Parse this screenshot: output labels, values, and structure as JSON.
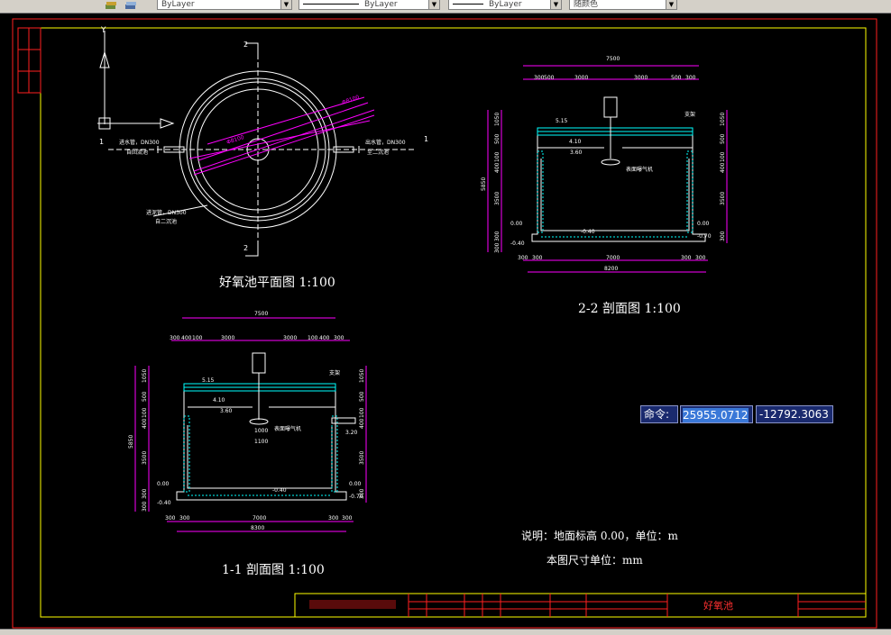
{
  "toolbar": {
    "layer_icon": "layers-icon",
    "layer_state_icon": "layer-states-icon",
    "color_value": "ByLayer",
    "linetype_value": "ByLayer",
    "lineweight_value": "ByLayer",
    "plotstyle_value": "随颜色"
  },
  "drawing": {
    "plan_title": "好氧池平面图 1:100",
    "section22_title": "2-2 剖面图 1:100",
    "section11_title": "1-1 剖面图 1:100",
    "note1": "说明：地面标高 0.00，单位：m",
    "note2": "本图尺寸单位：mm",
    "title_block_name": "好氧池",
    "plan": {
      "diameter": "Φ8100",
      "section_mark_2": "2",
      "section_mark_1": "1",
      "inlet_label": "进水管，DN300",
      "inlet_sub": "自回流池",
      "outlet_label": "出水管，DN300",
      "outlet_sub": "至二沉池",
      "bottom_label": "进泥管，DN300",
      "bottom_sub": "自二沉池",
      "axis_y": "Y",
      "axis_x": "X"
    },
    "sec22": {
      "total_width": "7500",
      "top_dims": [
        "300",
        "500",
        "3000",
        "3000",
        "500",
        "300"
      ],
      "bottom_dims": [
        "300",
        "300",
        "7000",
        "300",
        "300"
      ],
      "overall_bottom": "8200",
      "left_height": "5850",
      "left_dims": [
        "1050",
        "500",
        "100",
        "400",
        "3500",
        "300",
        "300"
      ],
      "right_dims": [
        "1050",
        "500",
        "100",
        "400",
        "3500",
        "300"
      ],
      "elev_top": "5.15",
      "elev_1": "4.10",
      "elev_2": "3.60",
      "elev_left": "0.00",
      "elev_left_low": "-0.40",
      "elev_bottom": "-0.40",
      "elev_right": "0.00",
      "elev_right_low": "-0.70",
      "label_motor": "支架",
      "label_aerator": "表面曝气机"
    },
    "sec11": {
      "total_width": "7500",
      "top_dims": [
        "300",
        "400",
        "100",
        "3000",
        "3000",
        "100",
        "400",
        "300"
      ],
      "bottom_dims": [
        "300",
        "300",
        "7000",
        "300",
        "300"
      ],
      "overall_bottom": "8300",
      "left_height": "5850",
      "left_dims": [
        "1050",
        "500",
        "100",
        "400",
        "3500",
        "300",
        "300"
      ],
      "right_dims": [
        "1050",
        "500",
        "100",
        "400",
        "3500",
        "300"
      ],
      "elev_top": "5.15",
      "elev_1": "4.10",
      "elev_2": "3.60",
      "elev_right": "3.20",
      "elev_left": "0.00",
      "elev_left_low": "-0.40",
      "elev_bottom": "-0.40",
      "elev_right_bottom": "0.00",
      "elev_right_low": "-0.70",
      "dim_1000": "1000",
      "dim_1100": "1100",
      "label_motor": "支架",
      "label_aerator": "表面曝气机"
    }
  },
  "command": {
    "label": "命令:",
    "x_value": "25955.0712",
    "y_value": "-12792.3063"
  }
}
